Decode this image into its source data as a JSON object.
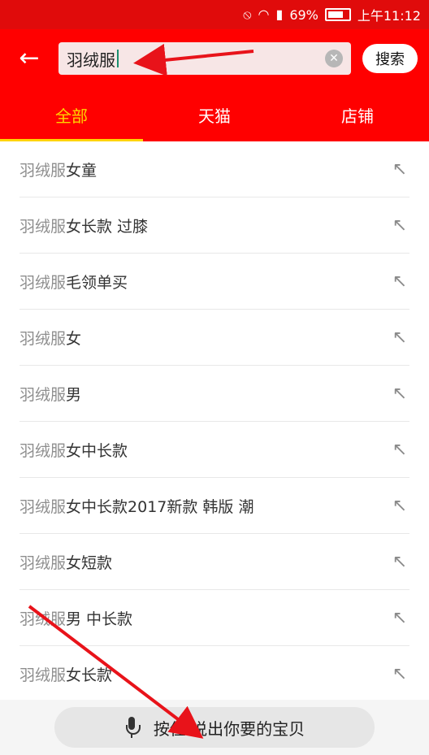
{
  "status_bar": {
    "battery": "69%",
    "time": "上午11:12",
    "icons": [
      "do-not-disturb-icon",
      "wifi-icon",
      "signal-icon",
      "battery-icon"
    ]
  },
  "header": {
    "back_icon": "arrow-left-icon",
    "search_text": "羽绒服",
    "clear_icon": "clear-icon",
    "search_button": "搜索"
  },
  "tabs": [
    {
      "label": "全部",
      "active": true
    },
    {
      "label": "天猫",
      "active": false
    },
    {
      "label": "店铺",
      "active": false
    }
  ],
  "suggestions": [
    {
      "prefix": "羽绒服",
      "suffix": "女童"
    },
    {
      "prefix": "羽绒服",
      "suffix": "女长款 过膝"
    },
    {
      "prefix": "羽绒服",
      "suffix": "毛领单买"
    },
    {
      "prefix": "羽绒服",
      "suffix": "女"
    },
    {
      "prefix": "羽绒服",
      "suffix": "男"
    },
    {
      "prefix": "羽绒服",
      "suffix": "女中长款"
    },
    {
      "prefix": "羽绒服",
      "suffix": "女中长款2017新款 韩版 潮"
    },
    {
      "prefix": "羽绒服",
      "suffix": "女短款"
    },
    {
      "prefix": "羽绒服",
      "suffix": "男 中长款"
    },
    {
      "prefix": "羽绒服",
      "suffix": "女长款"
    }
  ],
  "voice": {
    "label": "按住 说出你要的宝贝",
    "icon": "microphone-icon"
  },
  "colors": {
    "brand_red": "#ff0000",
    "status_red": "#e00b0b",
    "active_tab": "#ffd400",
    "annotation_arrow": "#e8131a"
  }
}
